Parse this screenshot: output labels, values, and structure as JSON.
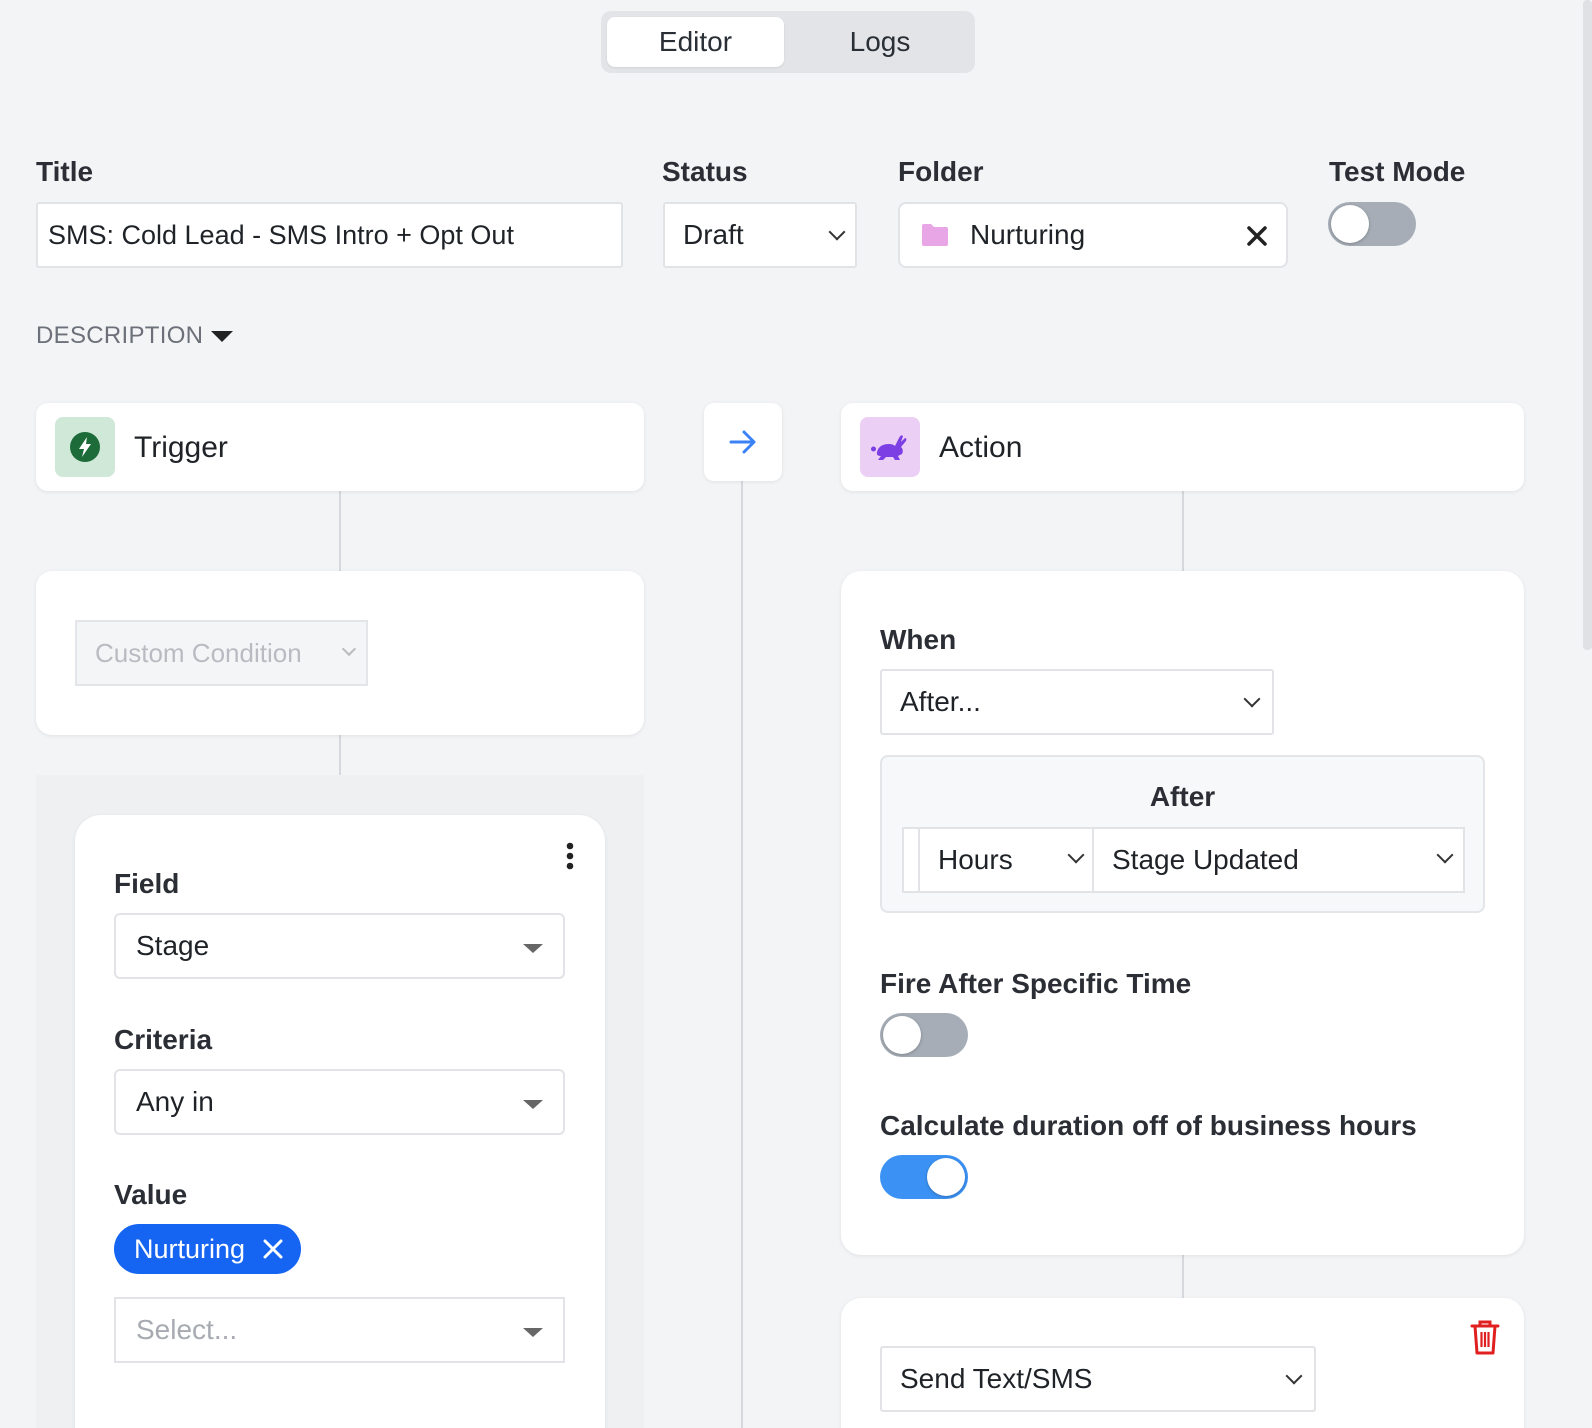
{
  "tabs": {
    "editor": "Editor",
    "logs": "Logs",
    "active": "Editor"
  },
  "form": {
    "title_label": "Title",
    "title_value": "SMS: Cold Lead - SMS Intro + Opt Out",
    "status_label": "Status",
    "status_value": "Draft",
    "folder_label": "Folder",
    "folder_value": "Nurturing",
    "test_mode_label": "Test Mode",
    "test_mode_on": false,
    "description_label": "DESCRIPTION"
  },
  "trigger": {
    "header": "Trigger",
    "condition_placeholder": "Custom Condition",
    "filter": {
      "field_label": "Field",
      "field_value": "Stage",
      "criteria_label": "Criteria",
      "criteria_value": "Any in",
      "value_label": "Value",
      "value_tag": "Nurturing",
      "select_placeholder": "Select..."
    }
  },
  "action": {
    "header": "Action",
    "when_label": "When",
    "when_value": "After...",
    "after_label": "After",
    "unit_value": "Hours",
    "event_value": "Stage Updated",
    "fire_after_label": "Fire After Specific Time",
    "fire_after_on": false,
    "business_hours_label": "Calculate duration off of business hours",
    "business_hours_on": true,
    "step_type_value": "Send Text/SMS"
  },
  "colors": {
    "accent": "#1565f2",
    "toggle_on": "#3b92f4",
    "delete": "#e02020"
  }
}
